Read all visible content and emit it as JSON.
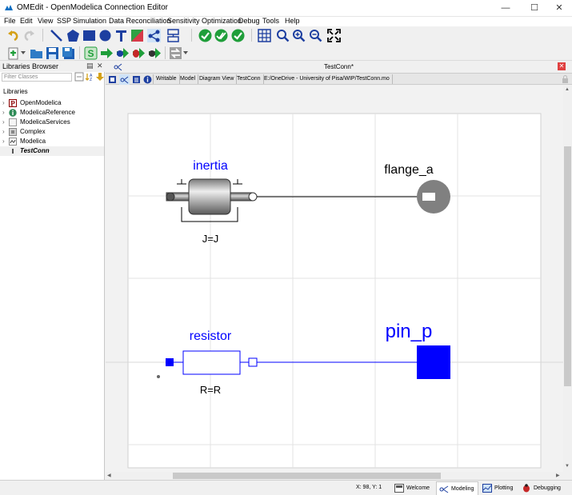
{
  "window": {
    "title": "OMEdit - OpenModelica Connection Editor"
  },
  "menu": [
    "File",
    "Edit",
    "View",
    "SSP",
    "Simulation",
    "Data Reconciliation",
    "Sensitivity Optimization",
    "Debug",
    "Tools",
    "Help"
  ],
  "libraries": {
    "title": "Libraries Browser",
    "filter_placeholder": "Filter Classes",
    "section": "Libraries",
    "items": [
      {
        "label": "OpenModelica",
        "icon": "openmodelica-icon"
      },
      {
        "label": "ModelicaReference",
        "icon": "info-icon"
      },
      {
        "label": "ModelicaServices",
        "icon": "package-icon"
      },
      {
        "label": "Complex",
        "icon": "record-icon"
      },
      {
        "label": "Modelica",
        "icon": "modelica-icon"
      },
      {
        "label": "TestConn",
        "icon": "model-icon"
      }
    ]
  },
  "editor": {
    "tab_title": "TestConn*",
    "toolbar": {
      "writable": "Writable",
      "kind": "Model",
      "view": "Diagram View",
      "name": "TestConn",
      "path": "E:/OneDrive - University of Pisa/WIP/TestConn.mo"
    }
  },
  "diagram": {
    "inertia": {
      "name": "inertia",
      "param": "J=J"
    },
    "flange": {
      "name": "flange_a"
    },
    "resistor": {
      "name": "resistor",
      "param": "R=R"
    },
    "pin": {
      "name": "pin_p"
    },
    "colors": {
      "electrical": "#0000ff",
      "mech_gray": "#808080"
    }
  },
  "status": {
    "coords": "X: 98, Y: 1",
    "tabs": [
      "Welcome",
      "Modeling",
      "Plotting",
      "Debugging"
    ],
    "active_tab": "Modeling"
  }
}
